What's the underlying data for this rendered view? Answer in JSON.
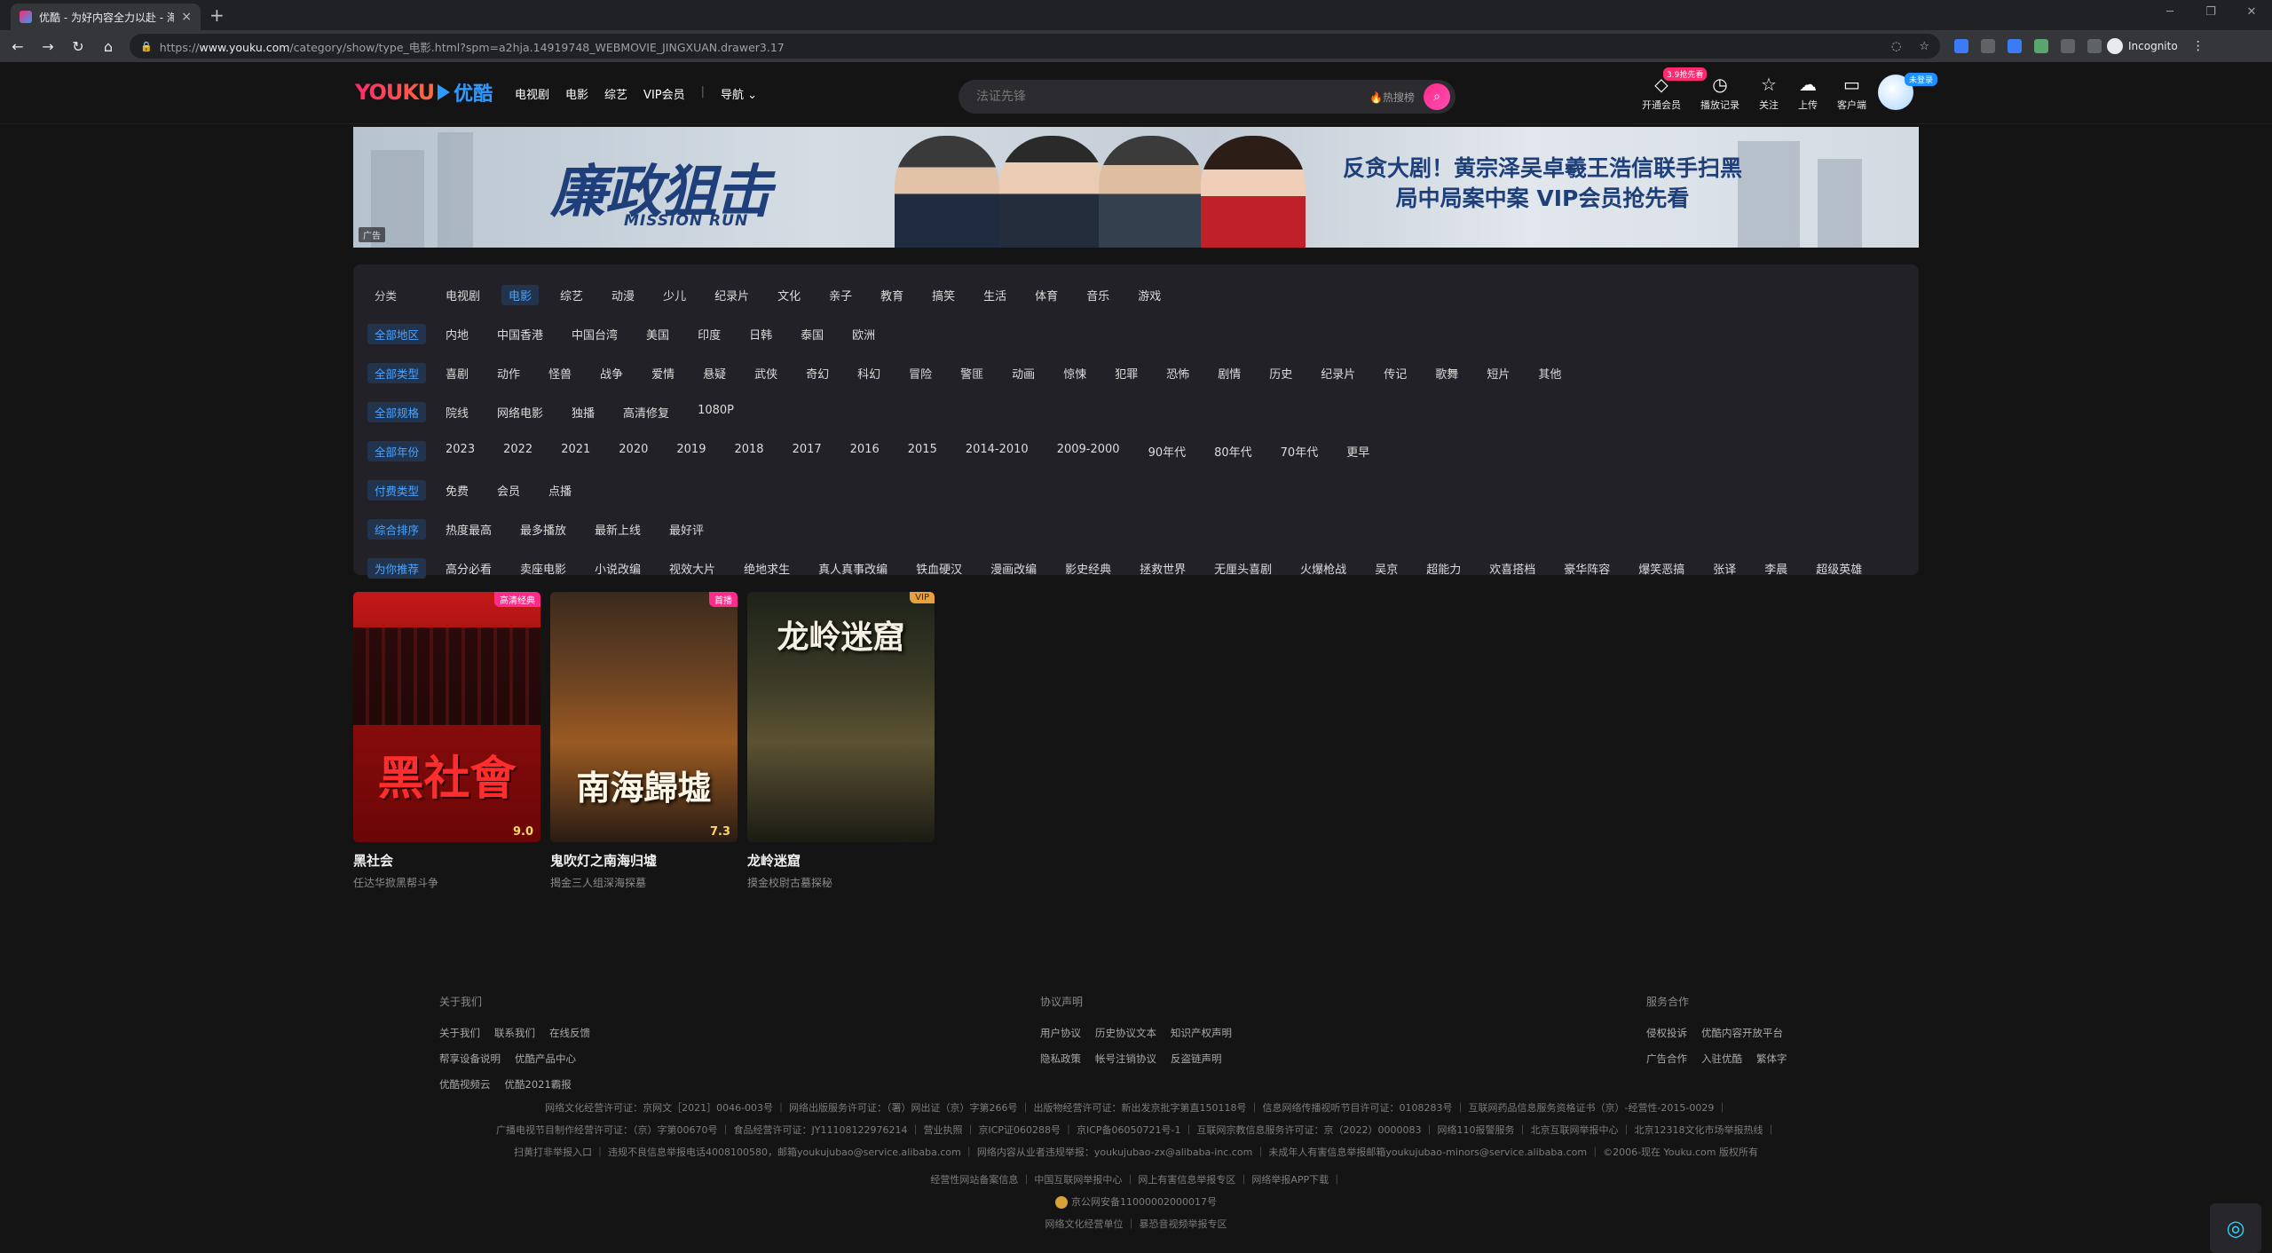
{
  "browser": {
    "tab_title": "优酷 - 为好内容全力以赴 - 海量正版高清视频在线观看",
    "tab_close": "×",
    "new_tab": "+",
    "url_host": "www.youku.com",
    "url_prefix": "https://",
    "url_path": "/category/show/type_电影.html?spm=a2hja.14919748_WEBMOVIE_JINGXUAN.drawer3.17",
    "incognito_label": "Incognito"
  },
  "header": {
    "logo_en": "YOUKU",
    "logo_cn": "优酷",
    "nav": [
      "电视剧",
      "电影",
      "综艺",
      "VIP会员"
    ],
    "nav_more": "导航",
    "search_placeholder": "法证先锋",
    "hot_search": "热搜榜",
    "actions": [
      {
        "icon": "diamond-icon",
        "label": "开通会员",
        "badge": "3.9抢先看"
      },
      {
        "icon": "history-icon",
        "label": "播放记录",
        "badge": ""
      },
      {
        "icon": "bookmark-icon",
        "label": "关注",
        "badge": ""
      },
      {
        "icon": "upload-icon",
        "label": "上传",
        "badge": ""
      },
      {
        "icon": "client-icon",
        "label": "客户端",
        "badge": ""
      }
    ],
    "avatar_badge": "未登录"
  },
  "banner": {
    "title": "廉政狙击",
    "subtitle": "MISSION RUN",
    "copy_line1": "反贪大剧！黄宗泽吴卓羲王浩信联手扫黑",
    "copy_line2": "局中局案中案 VIP会员抢先看",
    "ad_tag": "广告"
  },
  "filters": [
    {
      "label": "分类",
      "label_style": "plain",
      "items": [
        "电视剧",
        "电影",
        "综艺",
        "动漫",
        "少儿",
        "纪录片",
        "文化",
        "亲子",
        "教育",
        "搞笑",
        "生活",
        "体育",
        "音乐",
        "游戏"
      ],
      "active": "电影"
    },
    {
      "label": "全部地区",
      "label_style": "blue",
      "items": [
        "内地",
        "中国香港",
        "中国台湾",
        "美国",
        "印度",
        "日韩",
        "泰国",
        "欧洲"
      ],
      "active": ""
    },
    {
      "label": "全部类型",
      "label_style": "blue",
      "items": [
        "喜剧",
        "动作",
        "怪兽",
        "战争",
        "爱情",
        "悬疑",
        "武侠",
        "奇幻",
        "科幻",
        "冒险",
        "警匪",
        "动画",
        "惊悚",
        "犯罪",
        "恐怖",
        "剧情",
        "历史",
        "纪录片",
        "传记",
        "歌舞",
        "短片",
        "其他"
      ],
      "active": ""
    },
    {
      "label": "全部规格",
      "label_style": "blue",
      "items": [
        "院线",
        "网络电影",
        "独播",
        "高清修复",
        "1080P"
      ],
      "active": ""
    },
    {
      "label": "全部年份",
      "label_style": "blue",
      "items": [
        "2023",
        "2022",
        "2021",
        "2020",
        "2019",
        "2018",
        "2017",
        "2016",
        "2015",
        "2014-2010",
        "2009-2000",
        "90年代",
        "80年代",
        "70年代",
        "更早"
      ],
      "active": ""
    },
    {
      "label": "付费类型",
      "label_style": "blue",
      "items": [
        "免费",
        "会员",
        "点播"
      ],
      "active": ""
    },
    {
      "label": "综合排序",
      "label_style": "blue",
      "items": [
        "热度最高",
        "最多播放",
        "最新上线",
        "最好评"
      ],
      "active": ""
    },
    {
      "label": "为你推荐",
      "label_style": "blue",
      "items": [
        "高分必看",
        "卖座电影",
        "小说改编",
        "视效大片",
        "绝地求生",
        "真人真事改编",
        "铁血硬汉",
        "漫画改编",
        "影史经典",
        "拯救世界",
        "无厘头喜剧",
        "火爆枪战",
        "吴京",
        "超能力",
        "欢喜搭档",
        "豪华阵容",
        "爆笑恶搞",
        "张译",
        "李晨",
        "超级英雄"
      ],
      "active": ""
    }
  ],
  "posters": [
    {
      "title": "黑社会",
      "desc": "任达华掀黑帮斗争",
      "badge": "高清经典",
      "badge_style": "pink",
      "score": "9.0",
      "art_text": "黑社會"
    },
    {
      "title": "鬼吹灯之南海归墟",
      "desc": "揭金三人组深海探墓",
      "badge": "首播",
      "badge_style": "pink",
      "score": "7.3",
      "art_text": "南海歸墟"
    },
    {
      "title": "龙岭迷窟",
      "desc": "摸金校尉古墓探秘",
      "badge": "VIP",
      "badge_style": "gold",
      "score": "",
      "art_text": "龙岭迷窟"
    }
  ],
  "footer": {
    "columns": [
      {
        "title": "关于我们",
        "links": [
          "关于我们",
          "联系我们",
          "在线反馈",
          "帮享设备说明",
          "优酷产品中心",
          "优酷视频云",
          "优酷2021霸报"
        ]
      },
      {
        "title": "协议声明",
        "links": [
          "用户协议",
          "历史协议文本",
          "知识产权声明",
          "隐私政策",
          "帐号注销协议",
          "反盗链声明"
        ]
      },
      {
        "title": "服务合作",
        "links": [
          "侵权投诉",
          "优酷内容开放平台",
          "广告合作",
          "入驻优酷",
          "繁体字"
        ]
      }
    ],
    "legal_lines": [
      "网络文化经营许可证：京网文［2021］0046-003号 ｜ 网络出版服务许可证：（署）网出证（京）字第266号 ｜ 出版物经营许可证：新出发京批字第直150118号 ｜ 信息网络传播视听节目许可证：0108283号 ｜ 互联网药品信息服务资格证书（京）-经营性-2015-0029 ｜",
      "广播电视节目制作经营许可证：（京）字第00670号 ｜ 食品经营许可证：JY11108122976214 ｜ 营业执照 ｜ 京ICP证060288号 ｜ 京ICP备06050721号-1 ｜ 互联网宗教信息服务许可证：京（2022）0000083 ｜ 网络110报警服务 ｜ 北京互联网举报中心 ｜ 北京12318文化市场举报热线 ｜",
      "扫黄打非举报入口 ｜ 违规不良信息举报电话4008100580，邮箱youkujubao@service.alibaba.com ｜ 网络内容从业者违规举报：youkujubao-zx@alibaba-inc.com ｜ 未成年人有害信息举报邮箱youkujubao-minors@service.alibaba.com ｜ ©2006-现在 Youku.com 版权所有",
      "经营性网站备案信息 ｜ 中国互联网举报中心 ｜ 网上有害信息举报专区 ｜ 网络举报APP下载 ｜",
      "京公网安备11000002000017号",
      "网络文化经营单位 ｜ 暴恐音视频举报专区"
    ]
  }
}
